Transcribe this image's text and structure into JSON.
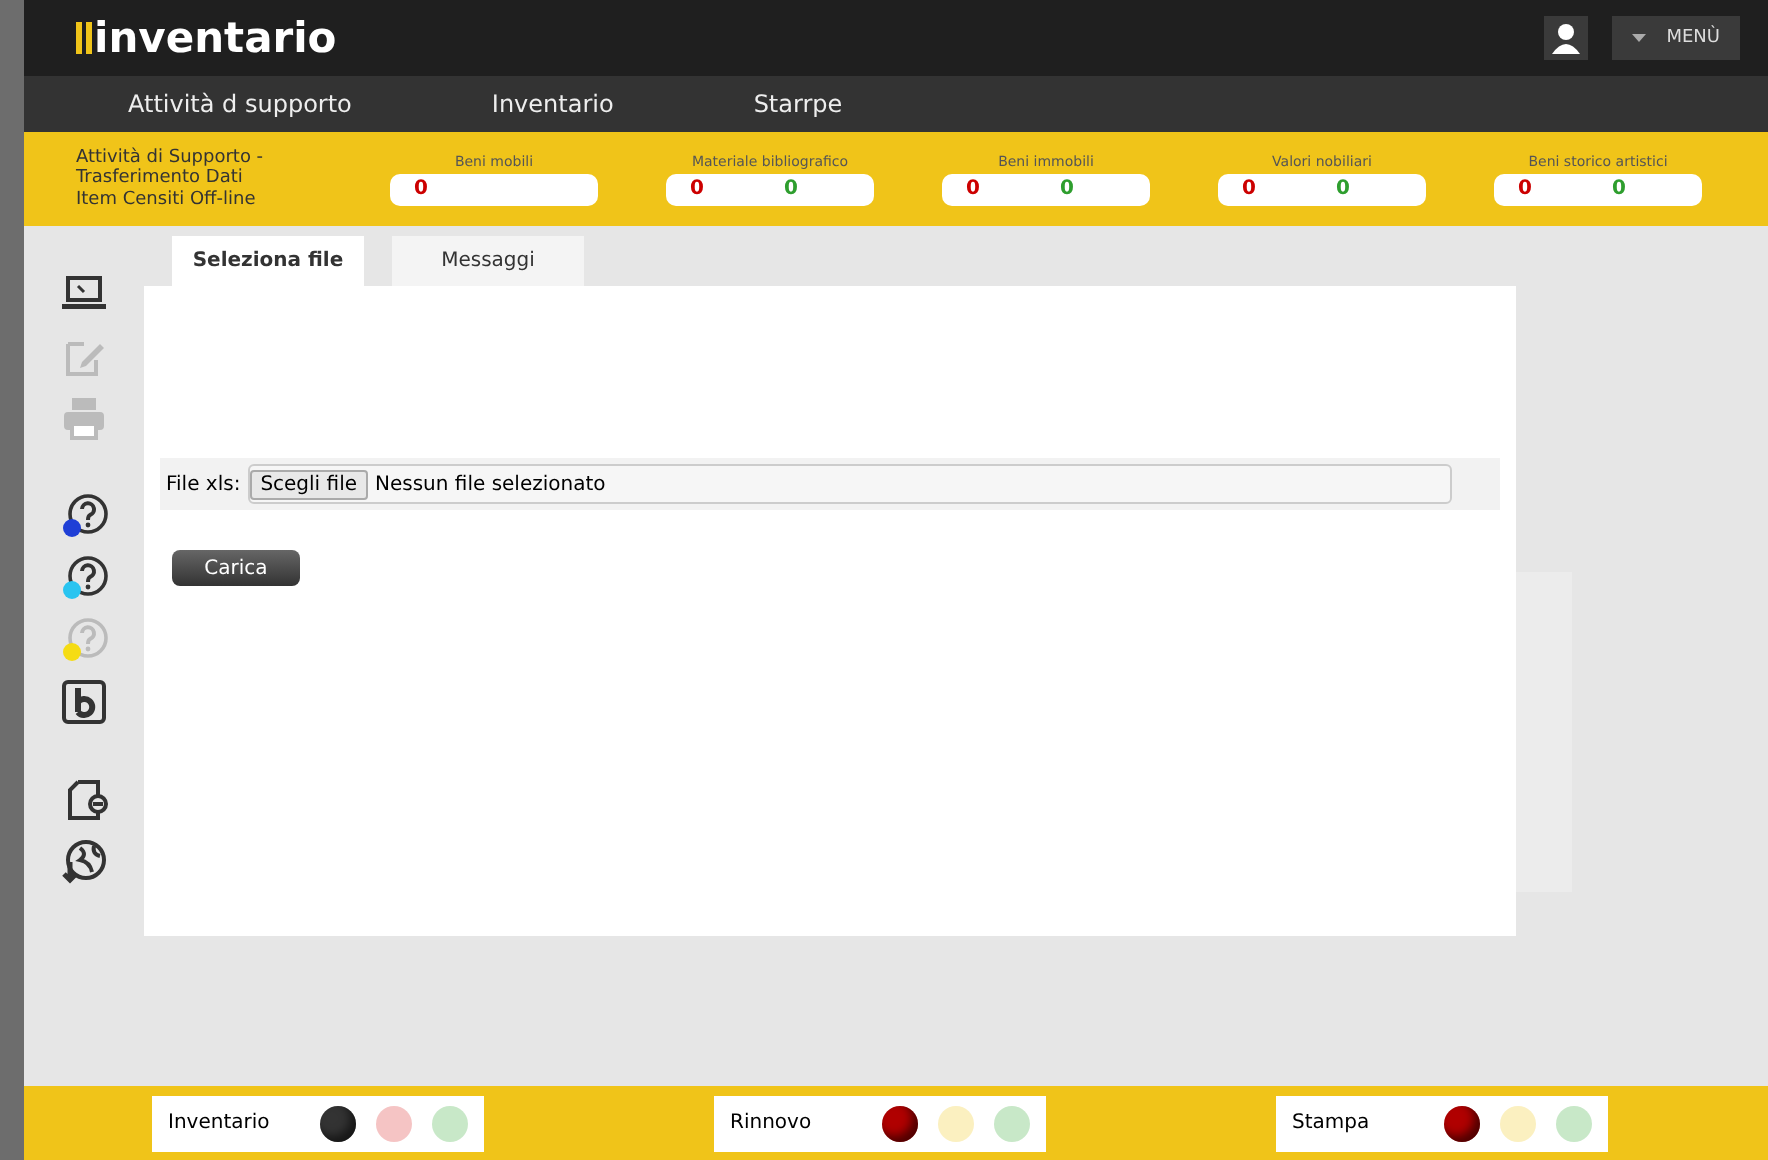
{
  "header": {
    "logo": "inventario",
    "menu_button": "MENÙ"
  },
  "nav": [
    "Attività d supporto",
    "Inventario",
    "Starrpe"
  ],
  "info_text": [
    "Attività di Supporto -",
    "Trasferimento Dati",
    "Item Censiti Off-line"
  ],
  "counters": [
    {
      "label": "Beni mobili",
      "values": [
        {
          "text": "0",
          "color": "#cc0000"
        }
      ]
    },
    {
      "label": "Materiale bibliografico",
      "values": [
        {
          "text": "0",
          "color": "#cc0000"
        },
        {
          "text": "0",
          "color": "#2e9e2e"
        }
      ]
    },
    {
      "label": "Beni immobili",
      "values": [
        {
          "text": "0",
          "color": "#cc0000"
        },
        {
          "text": "0",
          "color": "#2e9e2e"
        }
      ]
    },
    {
      "label": "Valori nobiliari",
      "values": [
        {
          "text": "0",
          "color": "#cc0000"
        },
        {
          "text": "0",
          "color": "#2e9e2e"
        }
      ]
    },
    {
      "label": "Beni storico artistici",
      "values": [
        {
          "text": "0",
          "color": "#cc0000"
        },
        {
          "text": "0",
          "color": "#2e9e2e"
        }
      ]
    }
  ],
  "sidebar": [
    {
      "kind": "laptop",
      "disabled": false
    },
    {
      "kind": "edit",
      "disabled": true
    },
    {
      "kind": "print",
      "disabled": true
    },
    {
      "kind": "help",
      "disabled": false,
      "color": "#1f3fd6"
    },
    {
      "kind": "help",
      "disabled": false,
      "color": "#29c4f0"
    },
    {
      "kind": "help",
      "disabled": true,
      "color": "#f5dc14"
    },
    {
      "kind": "b",
      "disabled": false
    },
    {
      "kind": "file-minus",
      "disabled": false
    },
    {
      "kind": "globe",
      "disabled": false
    }
  ],
  "tabs": [
    {
      "label": "Seleziona file",
      "selected": true
    },
    {
      "label": "Messaggi",
      "selected": false
    }
  ],
  "file_field": {
    "label": "File xls:",
    "button": "Scegli file",
    "value": "Nessun file selezionato"
  },
  "upload_button": "Carica",
  "status": [
    {
      "label": "Inventario",
      "lights": [
        {
          "color": "#333333",
          "on": true
        },
        {
          "color": "#f5c4c4",
          "on": false
        },
        {
          "color": "#c8e8c8",
          "on": false
        }
      ]
    },
    {
      "label": "Rinnovo",
      "lights": [
        {
          "color": "#b00000",
          "on": true
        },
        {
          "color": "#fbf0c0",
          "on": false
        },
        {
          "color": "#c8e8c8",
          "on": false
        }
      ]
    },
    {
      "label": "Stampa",
      "lights": [
        {
          "color": "#b00000",
          "on": true
        },
        {
          "color": "#fbf0c0",
          "on": false
        },
        {
          "color": "#c8e8c8",
          "on": false
        }
      ]
    }
  ]
}
